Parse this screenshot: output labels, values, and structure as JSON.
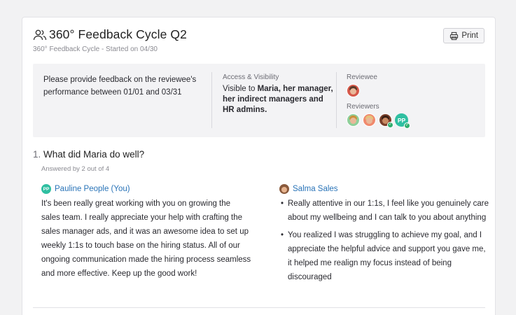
{
  "header": {
    "title": "360° Feedback Cycle Q2",
    "subtitle": "360° Feedback Cycle - Started on 04/30",
    "print_label": "Print"
  },
  "info": {
    "instructions": "Please provide feedback on the reviewee's performance between 01/01  and  03/31",
    "access_label": "Access & Visibility",
    "visible_prefix": "Visible to ",
    "visible_bold": "Maria, her manager, her indirect managers and HR admins.",
    "reviewee_label": "Reviewee",
    "reviewers_label": "Reviewers",
    "reviewer_initials": "PP"
  },
  "question": {
    "number": "1.",
    "text": "What did Maria do well?",
    "answered": "Answered by 2 out of 4"
  },
  "responses": [
    {
      "initials": "PP",
      "name": "Pauline People (You)",
      "body": "It's been really great working with you on growing the sales team. I really appreciate your help with crafting the sales manager ads, and it was an awesome idea to set up weekly 1:1s to touch base on the hiring status. All of our ongoing communication made the hiring process seamless and more effective. Keep up the good work!"
    },
    {
      "name": "Salma Sales",
      "bullets": [
        "Really attentive in our 1:1s, I feel like you genuinely care about my wellbeing and I can talk to you about anything",
        "You realized I was struggling to achieve my goal, and I appreciate the helpful advice and support you gave me, it helped me realign my focus instead of being discouraged"
      ]
    }
  ],
  "colors": {
    "accent": "#2a74b8",
    "pp_badge": "#2fbfa1",
    "check": "#2fae6e"
  }
}
